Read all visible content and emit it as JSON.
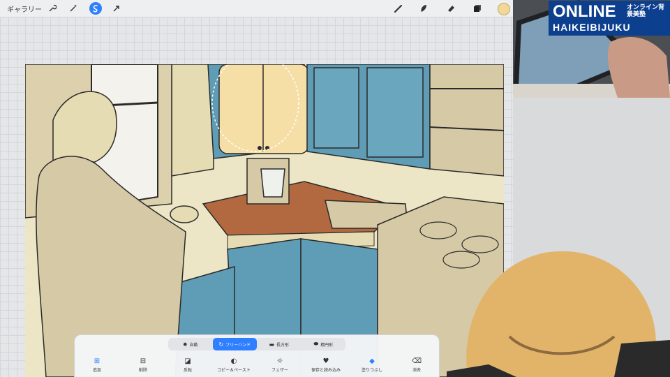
{
  "topbar": {
    "gallery_label": "ギャラリー",
    "left_icons": [
      "wrench-icon",
      "magic-wand-icon",
      "selection-icon",
      "transform-arrow-icon"
    ],
    "right_icons": [
      "brush-icon",
      "smudge-icon",
      "eraser-icon",
      "layers-icon",
      "color-swatch"
    ],
    "current_color": "#f2d897",
    "accent": "#2f7fff"
  },
  "selection_toolbar": {
    "modes": [
      {
        "label": "自動",
        "icon": "sun-icon",
        "active": false
      },
      {
        "label": "フリーハンド",
        "icon": "freehand-icon",
        "active": true
      },
      {
        "label": "長方形",
        "icon": "rectangle-icon",
        "active": false
      },
      {
        "label": "楕円形",
        "icon": "ellipse-icon",
        "active": false
      }
    ],
    "actions": [
      {
        "label": "追加",
        "icon": "plus-icon"
      },
      {
        "label": "削除",
        "icon": "minus-icon"
      },
      {
        "label": "反転",
        "icon": "invert-icon"
      },
      {
        "label": "コピー＆ペースト",
        "icon": "copy-paste-icon"
      },
      {
        "label": "フェザー",
        "icon": "feather-icon"
      },
      {
        "label": "保存と読み込み",
        "icon": "heart-icon"
      },
      {
        "label": "塗りつぶし",
        "icon": "fill-icon"
      },
      {
        "label": "消去",
        "icon": "clear-icon"
      }
    ]
  },
  "logo": {
    "line1": "ONLINE",
    "line1_sub": "オンライン背景美塾",
    "line2": "HAIKEIBIJUKU"
  },
  "colors": {
    "cabinet_blue": "#5e9db5",
    "wall_cream": "#ece6c6",
    "counter_brown": "#b3693f",
    "selected_door": "#f5dfa6",
    "tan": "#d6c9a6"
  }
}
